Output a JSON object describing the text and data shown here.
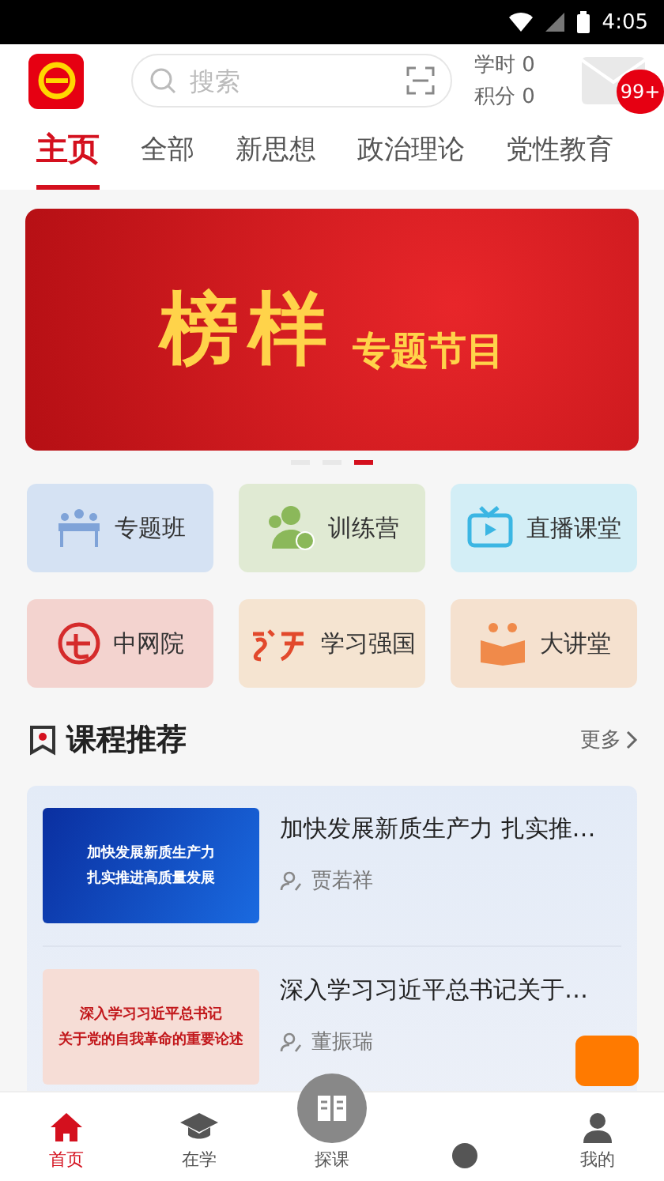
{
  "status_bar": {
    "time": "4:05"
  },
  "header": {
    "search": {
      "placeholder": "搜索"
    },
    "stats": [
      "学时 0",
      "积分 0"
    ],
    "message_badge": "99+"
  },
  "tabs": [
    {
      "label": "主页",
      "selected": true
    },
    {
      "label": "全部",
      "selected": false
    },
    {
      "label": "新思想",
      "selected": false
    },
    {
      "label": "政治理论",
      "selected": false
    },
    {
      "label": "党性教育",
      "selected": false
    }
  ],
  "banner": {
    "title": "榜样",
    "subtitle": "专题节目",
    "dots": [
      {
        "selected": false
      },
      {
        "selected": false
      },
      {
        "selected": true
      }
    ]
  },
  "shortcuts": [
    {
      "label": "专题班",
      "kind": "class",
      "color": "#d5e2f3"
    },
    {
      "label": "训练营",
      "kind": "camp",
      "color": "#e0ead3"
    },
    {
      "label": "直播课堂",
      "kind": "live",
      "color": "#d3eef6"
    },
    {
      "label": "中网院",
      "kind": "academy",
      "color": "#f3d3cf"
    },
    {
      "label": "学习强国",
      "kind": "study",
      "color": "#f5e4d1"
    },
    {
      "label": "大讲堂",
      "kind": "lecture",
      "color": "#f5e1cf"
    }
  ],
  "section": {
    "title": "课程推荐",
    "more": "更多"
  },
  "courses": [
    {
      "title": "加快发展新质生产力 扎实推…",
      "author": "贾若祥",
      "thumb_lines": [
        "加快发展新质生产力",
        "扎实推进高质量发展"
      ],
      "kind": "blue"
    },
    {
      "title": "深入学习习近平总书记关于…",
      "author": "董振瑞",
      "thumb_lines": [
        "深入学习习近平总书记",
        "关于党的自我革命的重要论述"
      ],
      "kind": "red"
    }
  ],
  "bottom_nav": [
    {
      "label": "首页",
      "kind": "home",
      "selected": true
    },
    {
      "label": "在学",
      "kind": "learning",
      "selected": false
    },
    {
      "label": "探课",
      "kind": "center",
      "selected": false
    },
    {
      "kind": "circle",
      "selected": false
    },
    {
      "label": "我的",
      "kind": "me",
      "selected": false
    }
  ]
}
